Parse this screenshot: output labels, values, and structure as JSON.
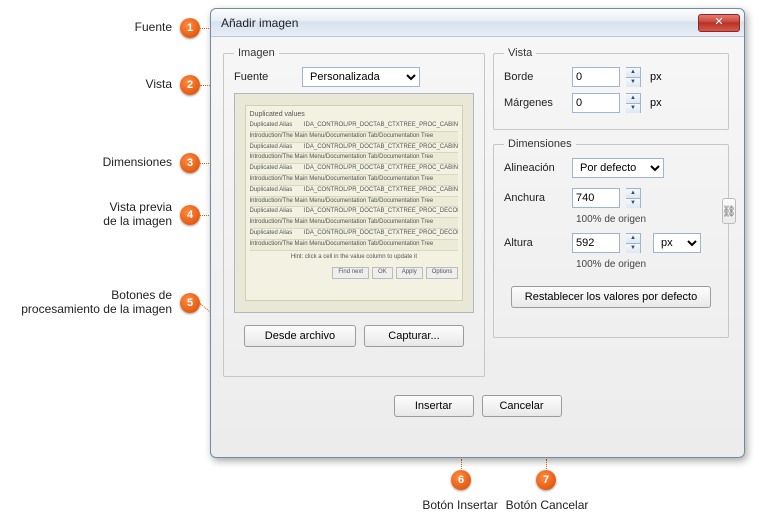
{
  "annotations": {
    "a1": "Fuente",
    "a2": "Vista",
    "a3": "Dimensiones",
    "a4": "Vista previa\nde la imagen",
    "a5": "Botones de\nprocesamiento de la imagen",
    "a6": "Botón Insertar",
    "a7": "Botón Cancelar",
    "b1": "1",
    "b2": "2",
    "b3": "3",
    "b4": "4",
    "b5": "5",
    "b6": "6",
    "b7": "7"
  },
  "dialog": {
    "title": "Añadir imagen",
    "close_label": "✕"
  },
  "imagen": {
    "legend": "Imagen",
    "fuente_label": "Fuente",
    "fuente_value": "Personalizada",
    "desde_archivo": "Desde archivo",
    "capturar": "Capturar..."
  },
  "vista": {
    "legend": "Vista",
    "borde_label": "Borde",
    "borde_value": "0",
    "borde_unit": "px",
    "margenes_label": "Márgenes",
    "margenes_value": "0",
    "margenes_unit": "px"
  },
  "dimensiones": {
    "legend": "Dimensiones",
    "alineacion_label": "Alineación",
    "alineacion_value": "Por defecto",
    "anchura_label": "Anchura",
    "anchura_value": "740",
    "anchura_note": "100% de origen",
    "altura_label": "Altura",
    "altura_value": "592",
    "altura_unit": "px",
    "altura_note": "100% de origen",
    "reset_label": "Restablecer los valores por defecto",
    "link_glyph": "⛓"
  },
  "footer": {
    "insertar": "Insertar",
    "cancelar": "Cancelar"
  },
  "chart_data": null
}
